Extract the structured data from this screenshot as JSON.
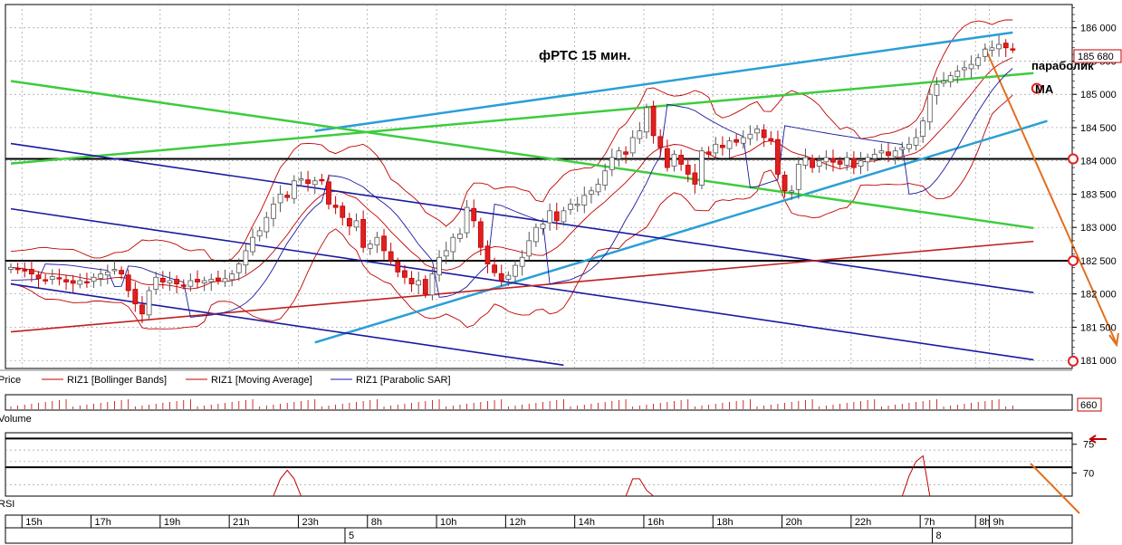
{
  "chart_data": {
    "type": "candlestick",
    "title": "фРТС   15 мин.",
    "annotations": [
      "параболик",
      "MA"
    ],
    "price_axis": {
      "ylim": [
        180880,
        186350
      ],
      "ticks": [
        {
          "label": "186 000",
          "value": 186000
        },
        {
          "label": "185 500",
          "value": 185500
        },
        {
          "label": "185 000",
          "value": 185000
        },
        {
          "label": "184 500",
          "value": 184500
        },
        {
          "label": "184 000",
          "value": 184000
        },
        {
          "label": "183 500",
          "value": 183500
        },
        {
          "label": "183 000",
          "value": 183000
        },
        {
          "label": "182 500",
          "value": 182500
        },
        {
          "label": "182 000",
          "value": 182000
        },
        {
          "label": "181 500",
          "value": 181500
        },
        {
          "label": "181 000",
          "value": 181000
        }
      ],
      "last_price_label": "185 680",
      "last_price": 185680
    },
    "volume_panel": {
      "label": "Volume",
      "value_label": "660"
    },
    "rsi_panel": {
      "label": "RSI",
      "ylim": [
        66,
        77
      ],
      "ticks": [
        {
          "label": "75",
          "value": 75
        },
        {
          "label": "70",
          "value": 70
        }
      ],
      "levels": [
        76,
        71
      ],
      "series": [
        [
          [
            38,
            66
          ],
          [
            39,
            69
          ],
          [
            40,
            70.5
          ],
          [
            41,
            69
          ],
          [
            42,
            66
          ]
        ],
        [
          [
            89,
            66
          ],
          [
            90,
            69
          ],
          [
            91,
            69
          ],
          [
            92,
            67
          ],
          [
            93,
            66
          ]
        ],
        [
          [
            129,
            66
          ],
          [
            130,
            69.5
          ],
          [
            131,
            72
          ],
          [
            132,
            73
          ],
          [
            133,
            66
          ]
        ],
        [
          [
            168,
            66
          ],
          [
            169,
            72
          ],
          [
            170,
            73.5
          ],
          [
            171,
            74
          ],
          [
            172,
            73.5
          ],
          [
            173,
            74.8
          ],
          [
            174,
            74.5
          ],
          [
            175,
            73.5
          ],
          [
            176,
            75
          ],
          [
            177,
            76
          ],
          [
            178,
            75
          ],
          [
            179,
            73.8
          ],
          [
            180,
            74.2
          ],
          [
            181,
            74.6
          ],
          [
            182,
            73.5
          ],
          [
            183,
            73.8
          ],
          [
            184,
            74.1
          ],
          [
            185,
            73.4
          ],
          [
            186,
            72.3
          ]
        ]
      ]
    },
    "time_axis": {
      "ticks": [
        {
          "label": "15h",
          "bar": 2
        },
        {
          "label": "17h",
          "bar": 12
        },
        {
          "label": "19h",
          "bar": 22
        },
        {
          "label": "21h",
          "bar": 32
        },
        {
          "label": "23h",
          "bar": 42
        },
        {
          "label": "8h",
          "bar": 52
        },
        {
          "label": "10h",
          "bar": 62
        },
        {
          "label": "12h",
          "bar": 72
        },
        {
          "label": "14h",
          "bar": 82
        },
        {
          "label": "16h",
          "bar": 92
        },
        {
          "label": "18h",
          "bar": 102
        },
        {
          "label": "20h",
          "bar": 112
        },
        {
          "label": "22h",
          "bar": 122
        },
        {
          "label": "7h",
          "bar": 132
        },
        {
          "label": "8h",
          "bar": 140
        },
        {
          "label": "9h",
          "bar": 142
        }
      ],
      "day_markers": [
        {
          "label": "5",
          "bar": 46
        },
        {
          "label": "8",
          "bar": 131
        }
      ]
    },
    "legend": [
      {
        "name": "Price",
        "color": "#c00000"
      },
      {
        "name": "RIZ1 [Bollinger Bands]",
        "color": "#c00000"
      },
      {
        "name": "RIZ1 [Moving Average]",
        "color": "#c00000"
      },
      {
        "name": "RIZ1 [Parabolic SAR]",
        "color": "#1a1aa0"
      }
    ],
    "horizontal_levels": [
      184030,
      182500
    ],
    "trendlines": [
      {
        "color": "#2a9fd6",
        "from": [
          44,
          184450
        ],
        "to": [
          145,
          185930
        ]
      },
      {
        "color": "#2a9fd6",
        "from": [
          44,
          181270
        ],
        "to": [
          150,
          184600
        ]
      },
      {
        "color": "#3dcc3d",
        "from": [
          0,
          185200
        ],
        "to": [
          148,
          182990
        ]
      },
      {
        "color": "#3dcc3d",
        "from": [
          0,
          183960
        ],
        "to": [
          148,
          185320
        ]
      },
      {
        "color": "#1a1aa0",
        "from": [
          0,
          184260
        ],
        "to": [
          148,
          182020
        ]
      },
      {
        "color": "#1a1aa0",
        "from": [
          0,
          183280
        ],
        "to": [
          148,
          181010
        ]
      },
      {
        "color": "#1a1aa0",
        "from": [
          0,
          182150
        ],
        "to": [
          80,
          180930
        ]
      },
      {
        "color": "#c02020",
        "from": [
          0,
          181430
        ],
        "to": [
          148,
          182790
        ]
      },
      {
        "color": "#e07020",
        "from": [
          141,
          185700
        ],
        "to": [
          153,
          181450
        ]
      }
    ],
    "circle_markers": [
      [
        148,
        184030
      ],
      [
        148,
        182500
      ],
      [
        148,
        180990
      ],
      [
        141,
        185090
      ]
    ],
    "candles_close_path": [
      [
        0,
        182400
      ],
      [
        1,
        182380
      ],
      [
        2,
        182350
      ],
      [
        3,
        182300
      ],
      [
        4,
        182230
      ],
      [
        5,
        182200
      ],
      [
        6,
        182260
      ],
      [
        7,
        182230
      ],
      [
        8,
        182180
      ],
      [
        9,
        182160
      ],
      [
        10,
        182200
      ],
      [
        11,
        182170
      ],
      [
        12,
        182250
      ],
      [
        13,
        182300
      ],
      [
        14,
        182330
      ],
      [
        15,
        182370
      ],
      [
        16,
        182300
      ],
      [
        17,
        182050
      ],
      [
        18,
        181850
      ],
      [
        19,
        181700
      ],
      [
        20,
        182050
      ],
      [
        21,
        182250
      ],
      [
        22,
        182180
      ],
      [
        23,
        182200
      ],
      [
        24,
        182150
      ],
      [
        25,
        182130
      ],
      [
        26,
        182200
      ],
      [
        27,
        182180
      ],
      [
        28,
        182200
      ],
      [
        29,
        182220
      ],
      [
        30,
        182200
      ],
      [
        31,
        182230
      ],
      [
        32,
        182300
      ],
      [
        33,
        182450
      ],
      [
        34,
        182650
      ],
      [
        35,
        182850
      ],
      [
        36,
        182950
      ],
      [
        37,
        183150
      ],
      [
        38,
        183350
      ],
      [
        39,
        183500
      ],
      [
        40,
        183450
      ],
      [
        41,
        183700
      ],
      [
        42,
        183730
      ],
      [
        43,
        183660
      ],
      [
        44,
        183700
      ],
      [
        45,
        183700
      ],
      [
        46,
        183350
      ],
      [
        47,
        183300
      ],
      [
        48,
        183150
      ],
      [
        49,
        183020
      ],
      [
        50,
        183100
      ],
      [
        51,
        182700
      ],
      [
        52,
        182750
      ],
      [
        53,
        182850
      ],
      [
        54,
        182650
      ],
      [
        55,
        182500
      ],
      [
        56,
        182330
      ],
      [
        57,
        182250
      ],
      [
        58,
        182150
      ],
      [
        59,
        182200
      ],
      [
        60,
        182000
      ],
      [
        61,
        182300
      ],
      [
        62,
        182550
      ],
      [
        63,
        182650
      ],
      [
        64,
        182850
      ],
      [
        65,
        182900
      ],
      [
        66,
        183300
      ],
      [
        67,
        183100
      ],
      [
        68,
        182700
      ],
      [
        69,
        182450
      ],
      [
        70,
        182320
      ],
      [
        71,
        182200
      ],
      [
        72,
        182280
      ],
      [
        73,
        182430
      ],
      [
        74,
        182550
      ],
      [
        75,
        182800
      ],
      [
        76,
        183000
      ],
      [
        77,
        183050
      ],
      [
        78,
        183250
      ],
      [
        79,
        183100
      ],
      [
        80,
        183250
      ],
      [
        81,
        183350
      ],
      [
        82,
        183350
      ],
      [
        83,
        183480
      ],
      [
        84,
        183550
      ],
      [
        85,
        183650
      ],
      [
        86,
        183850
      ],
      [
        87,
        184050
      ],
      [
        88,
        184150
      ],
      [
        89,
        184100
      ],
      [
        90,
        184350
      ],
      [
        91,
        184450
      ],
      [
        92,
        184800
      ],
      [
        93,
        184380
      ],
      [
        94,
        184200
      ],
      [
        95,
        183900
      ],
      [
        96,
        184100
      ],
      [
        97,
        183950
      ],
      [
        98,
        183800
      ],
      [
        99,
        183650
      ],
      [
        100,
        184150
      ],
      [
        101,
        184100
      ],
      [
        102,
        184250
      ],
      [
        103,
        184200
      ],
      [
        104,
        184300
      ],
      [
        105,
        184280
      ],
      [
        106,
        184350
      ],
      [
        107,
        184400
      ],
      [
        108,
        184480
      ],
      [
        109,
        184350
      ],
      [
        110,
        184300
      ],
      [
        111,
        183800
      ],
      [
        112,
        183550
      ],
      [
        113,
        183550
      ],
      [
        114,
        183950
      ],
      [
        115,
        184050
      ],
      [
        116,
        183900
      ],
      [
        117,
        184000
      ],
      [
        118,
        184050
      ],
      [
        119,
        183980
      ],
      [
        120,
        183950
      ],
      [
        121,
        184050
      ],
      [
        122,
        183900
      ],
      [
        123,
        184000
      ],
      [
        124,
        184050
      ],
      [
        125,
        184100
      ],
      [
        126,
        184150
      ],
      [
        127,
        184080
      ],
      [
        128,
        184150
      ],
      [
        129,
        184200
      ],
      [
        130,
        184250
      ],
      [
        131,
        184350
      ],
      [
        132,
        184600
      ],
      [
        133,
        185000
      ],
      [
        134,
        185150
      ],
      [
        135,
        185200
      ],
      [
        136,
        185280
      ],
      [
        137,
        185350
      ],
      [
        138,
        185400
      ],
      [
        139,
        185450
      ],
      [
        140,
        185550
      ],
      [
        141,
        185680
      ],
      [
        142,
        185700
      ],
      [
        143,
        185750
      ],
      [
        144,
        185700
      ],
      [
        145,
        185680
      ]
    ]
  }
}
